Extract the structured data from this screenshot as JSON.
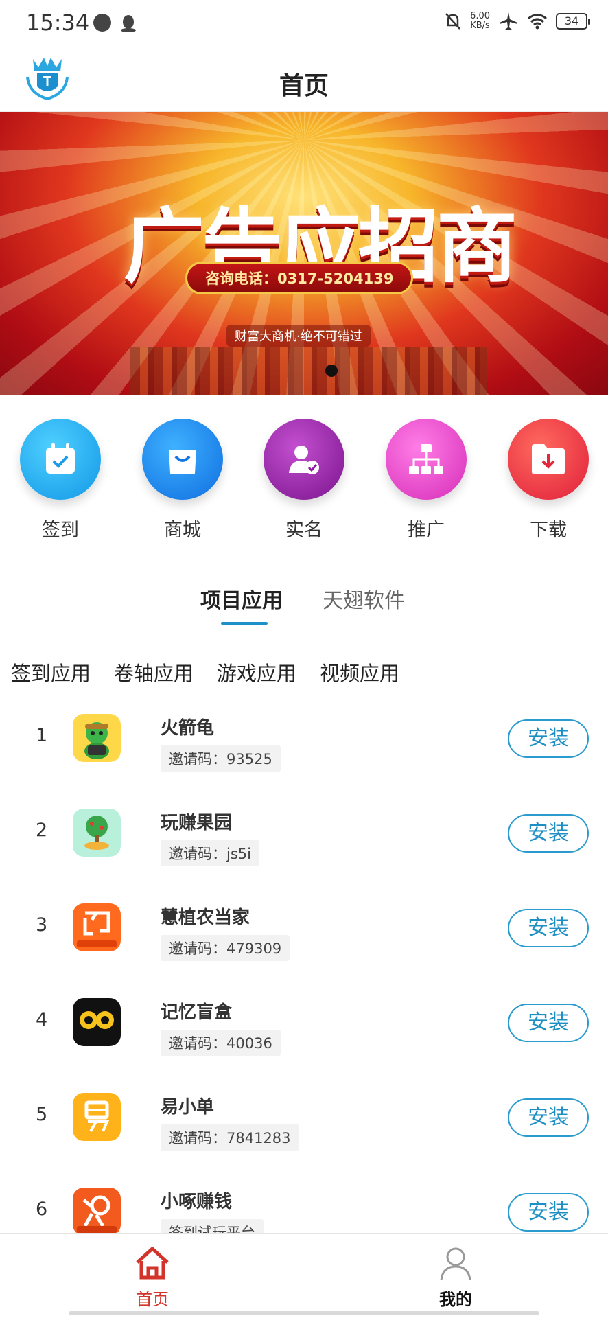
{
  "status_bar": {
    "time": "15:34",
    "net_speed_value": "6.00",
    "net_speed_unit": "KB/s",
    "battery": "34",
    "icons": [
      "settings-dot-icon",
      "qq-icon",
      "mute-icon",
      "airplane-icon",
      "wifi-icon",
      "battery-icon"
    ]
  },
  "header": {
    "title": "首页",
    "logo_icon": "crown-shield-logo-icon"
  },
  "banner": {
    "title": "广告应招商",
    "phone": "咨询电话：0317-5204139",
    "slogan": "财富大商机·绝不可错过",
    "colors": [
      "#b10d14",
      "#e0381e",
      "#f7b52a",
      "#ffe27a"
    ]
  },
  "quick_menu": {
    "items": [
      {
        "label": "签到",
        "icon": "calendar-check-icon",
        "color": "#22a7ee"
      },
      {
        "label": "商城",
        "icon": "shopping-bag-icon",
        "color": "#1c87e8"
      },
      {
        "label": "实名",
        "icon": "user-verified-icon",
        "color": "#9b22a8"
      },
      {
        "label": "推广",
        "icon": "hierarchy-icon",
        "color": "#e843c8"
      },
      {
        "label": "下载",
        "icon": "folder-download-icon",
        "color": "#ef3c3c"
      }
    ]
  },
  "tabs": {
    "active": "项目应用",
    "inactive": "天翅软件",
    "accent": "#1e90c8"
  },
  "categories": [
    "签到应用",
    "卷轴应用",
    "游戏应用",
    "视频应用"
  ],
  "apps": [
    {
      "rank": "1",
      "name": "火箭龟",
      "code": "邀请码：93525",
      "button": "安装",
      "icon": "turtle-app-icon"
    },
    {
      "rank": "2",
      "name": "玩赚果园",
      "code": "邀请码：js5i",
      "button": "安装",
      "icon": "tree-app-icon"
    },
    {
      "rank": "3",
      "name": "慧植农当家",
      "code": "邀请码：479309",
      "button": "安装",
      "icon": "orange-bag-app-icon"
    },
    {
      "rank": "4",
      "name": "记忆盲盒",
      "code": "邀请码：40036",
      "button": "安装",
      "icon": "owl-eyes-app-icon"
    },
    {
      "rank": "5",
      "name": "易小单",
      "code": "邀请码：7841283",
      "button": "安装",
      "icon": "yi-app-icon"
    },
    {
      "rank": "6",
      "name": "小啄赚钱",
      "code": "签到试玩平台",
      "button": "安装",
      "icon": "bird-app-icon"
    }
  ],
  "bottom_nav": {
    "home": "首页",
    "mine": "我的",
    "home_color": "#d2332a"
  }
}
